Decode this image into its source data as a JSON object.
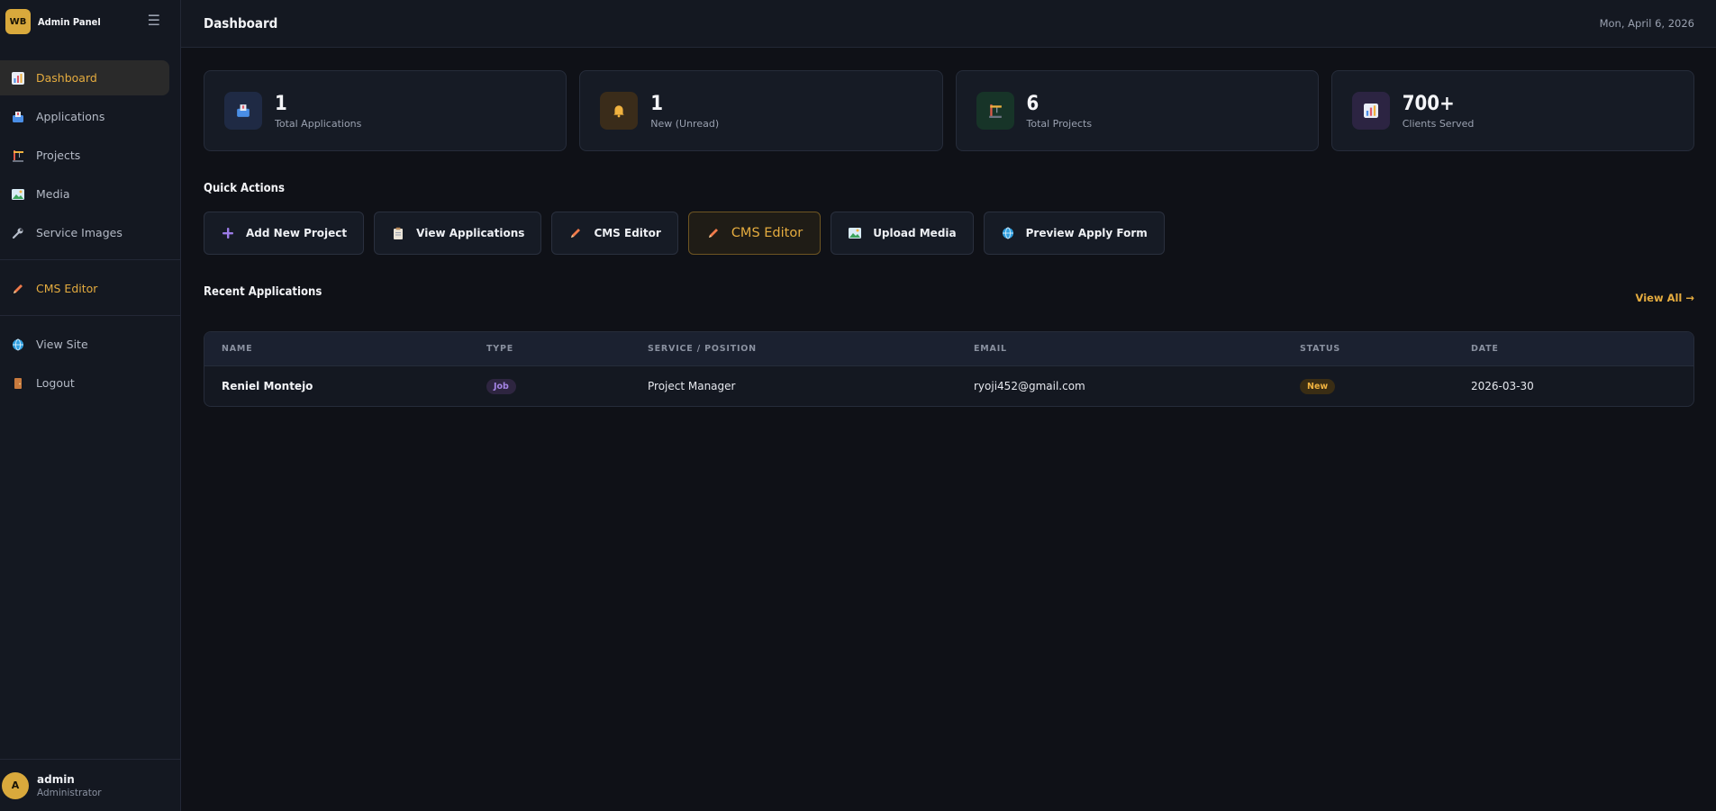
{
  "brand": {
    "logo": "WB",
    "title": "Admin Panel",
    "menu_icon": "hamburger-icon"
  },
  "sidebar": {
    "items": [
      {
        "label": "Dashboard",
        "icon": "chart-icon"
      },
      {
        "label": "Applications",
        "icon": "inbox-icon"
      },
      {
        "label": "Projects",
        "icon": "construction-icon"
      },
      {
        "label": "Media",
        "icon": "image-icon"
      },
      {
        "label": "Service Images",
        "icon": "wrench-icon"
      },
      {
        "label": "CMS Editor",
        "icon": "pencil-icon"
      },
      {
        "label": "View Site",
        "icon": "globe-icon"
      },
      {
        "label": "Logout",
        "icon": "door-icon"
      }
    ]
  },
  "user": {
    "avatar": "A",
    "name": "admin",
    "role": "Administrator"
  },
  "header": {
    "title": "Dashboard",
    "date": "Mon, April 6, 2026"
  },
  "stats": [
    {
      "value": "1",
      "label": "Total Applications",
      "icon": "inbox-icon"
    },
    {
      "value": "1",
      "label": "New (Unread)",
      "icon": "bell-icon"
    },
    {
      "value": "6",
      "label": "Total Projects",
      "icon": "construction-icon"
    },
    {
      "value": "700+",
      "label": "Clients Served",
      "icon": "chart-icon"
    }
  ],
  "quick_actions": {
    "title": "Quick Actions",
    "items": [
      {
        "label": "Add New Project",
        "icon": "plus-icon"
      },
      {
        "label": "View Applications",
        "icon": "clipboard-icon"
      },
      {
        "label": "CMS Editor",
        "icon": "pencil-icon"
      },
      {
        "label": "CMS Editor",
        "icon": "pencil-icon"
      },
      {
        "label": "Upload Media",
        "icon": "image-icon"
      },
      {
        "label": "Preview Apply Form",
        "icon": "globe-icon"
      }
    ]
  },
  "recent": {
    "title": "Recent Applications",
    "view_all": "View All →",
    "columns": [
      "NAME",
      "TYPE",
      "SERVICE / POSITION",
      "EMAIL",
      "STATUS",
      "DATE"
    ],
    "rows": [
      {
        "name": "Reniel Montejo",
        "type": "Job",
        "position": "Project Manager",
        "email": "ryoji452@gmail.com",
        "status": "New",
        "date": "2026-03-30"
      }
    ]
  },
  "colors": {
    "accent": "#e5ac3f",
    "background": "#0f1117",
    "sidebar": "#141821"
  }
}
